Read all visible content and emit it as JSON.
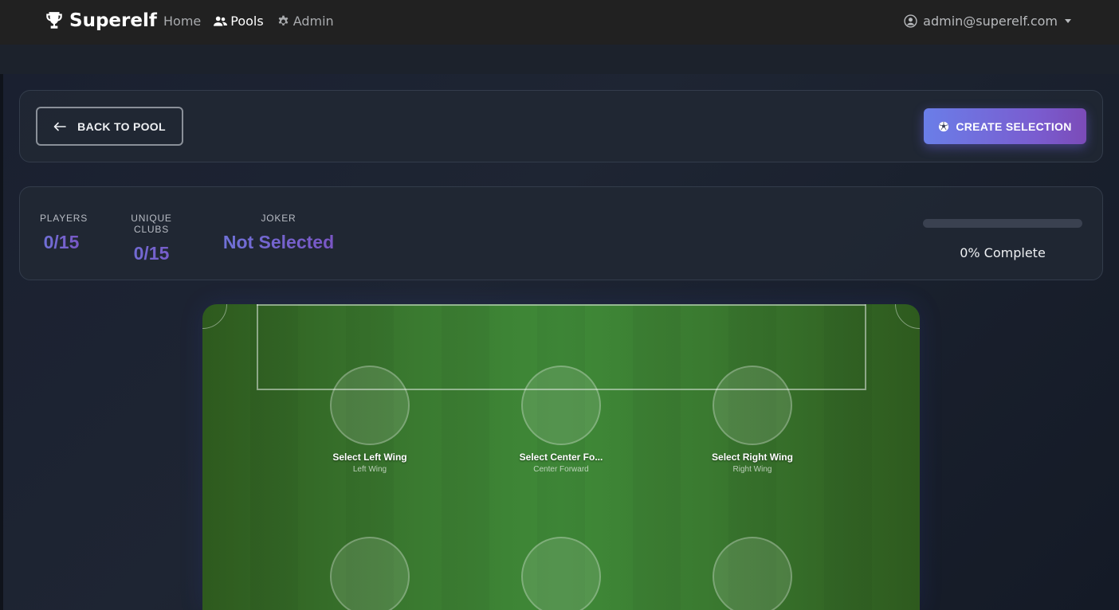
{
  "navbar": {
    "brand": "Superelf",
    "links": [
      {
        "label": "Home"
      },
      {
        "label": "Pools"
      },
      {
        "label": "Admin"
      }
    ],
    "user_email": "admin@superelf.com"
  },
  "actions": {
    "back_label": "BACK TO POOL",
    "create_label": "CREATE SELECTION"
  },
  "stats": {
    "players_label": "PLAYERS",
    "players_value": "0/15",
    "clubs_label": "UNIQUE CLUBS",
    "clubs_value": "0/15",
    "joker_label": "JOKER",
    "joker_value": "Not Selected",
    "progress_fraction": 0,
    "progress_text": "0% Complete"
  },
  "pitch": {
    "slots": [
      {
        "name": "Select Left Wing",
        "position": "Left Wing"
      },
      {
        "name": "Select Center Fo...",
        "position": "Center Forward"
      },
      {
        "name": "Select Right Wing",
        "position": "Right Wing"
      },
      {
        "name": "",
        "position": ""
      },
      {
        "name": "",
        "position": ""
      },
      {
        "name": "",
        "position": ""
      }
    ]
  },
  "colors": {
    "accent_start": "#6a7ee8",
    "accent_end": "#7a5ccf",
    "navbar_bg": "#212121",
    "pitch_green": "#3f8a38"
  }
}
